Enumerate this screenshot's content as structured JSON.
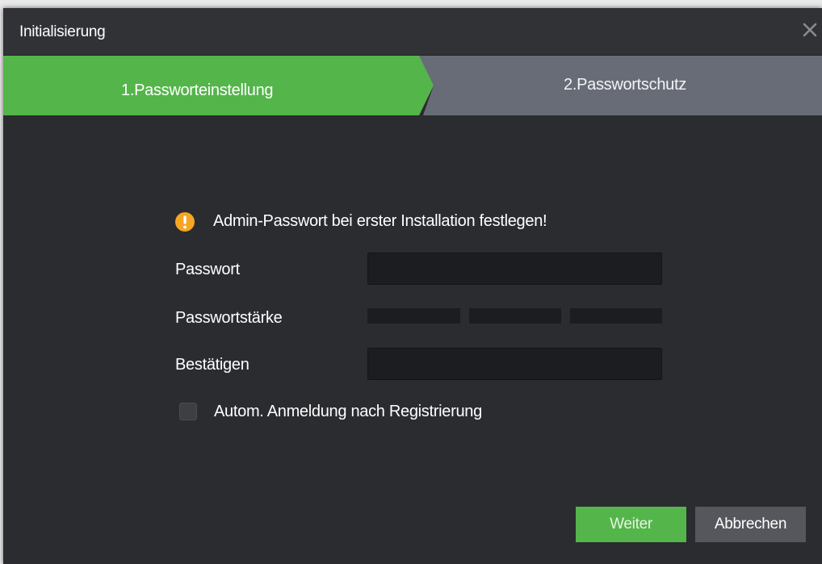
{
  "window": {
    "title": "Initialisierung"
  },
  "steps": [
    {
      "label": "1.Passworteinstellung",
      "active": true,
      "color": "#54b54a"
    },
    {
      "label": "2.Passwortschutz",
      "active": false,
      "color": "#686c76"
    }
  ],
  "form": {
    "warning": "Admin-Passwort bei erster Installation festlegen!",
    "password_label": "Passwort",
    "password_value": "",
    "strength_label": "Passwortstärke",
    "confirm_label": "Bestätigen",
    "confirm_value": "",
    "auto_login_label": "Autom. Anmeldung nach Registrierung",
    "auto_login_checked": false
  },
  "buttons": {
    "next": "Weiter",
    "cancel": "Abbrechen"
  },
  "colors": {
    "accent": "#54b54a",
    "warning": "#f5a623",
    "background": "#2b2c30"
  }
}
